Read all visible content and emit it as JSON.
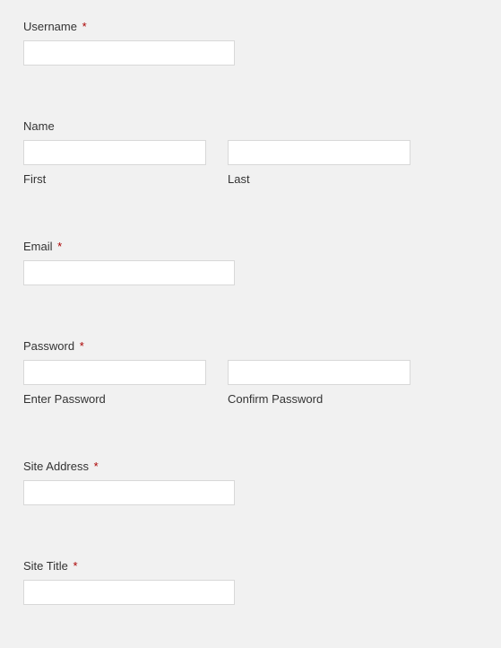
{
  "fields": {
    "username": {
      "label": "Username"
    },
    "name": {
      "label": "Name",
      "first_sub": "First",
      "last_sub": "Last"
    },
    "email": {
      "label": "Email"
    },
    "password": {
      "label": "Password",
      "enter_sub": "Enter Password",
      "confirm_sub": "Confirm Password"
    },
    "site_address": {
      "label": "Site Address"
    },
    "site_title": {
      "label": "Site Title"
    }
  },
  "required_marker": "*"
}
